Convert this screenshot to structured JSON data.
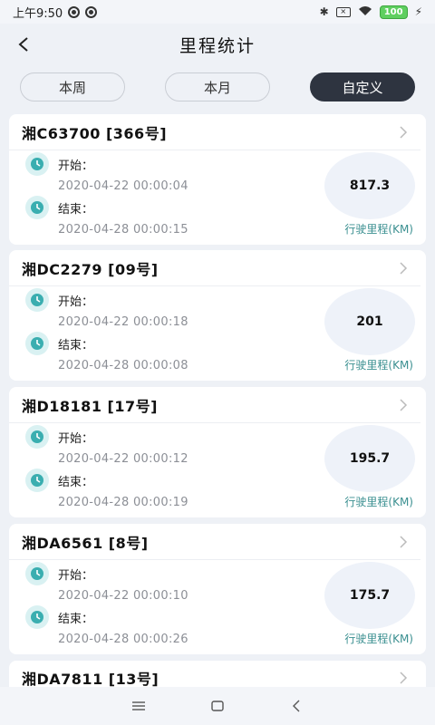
{
  "status_bar": {
    "time": "上午9:50",
    "battery": "100"
  },
  "header": {
    "title": "里程统计"
  },
  "filters": [
    {
      "label": "本周",
      "active": false
    },
    {
      "label": "本月",
      "active": false
    },
    {
      "label": "自定义",
      "active": true
    }
  ],
  "records": [
    {
      "plate": "湘C63700 [366号]",
      "start_label": "开始：",
      "start_time": "2020-04-22 00:00:04",
      "end_label": "结束：",
      "end_time": "2020-04-28 00:00:15",
      "mileage": "817.3",
      "mileage_label": "行驶里程(KM)"
    },
    {
      "plate": "湘DC2279 [09号]",
      "start_label": "开始：",
      "start_time": "2020-04-22 00:00:18",
      "end_label": "结束：",
      "end_time": "2020-04-28 00:00:08",
      "mileage": "201",
      "mileage_label": "行驶里程(KM)"
    },
    {
      "plate": "湘D18181 [17号]",
      "start_label": "开始：",
      "start_time": "2020-04-22 00:00:12",
      "end_label": "结束：",
      "end_time": "2020-04-28 00:00:19",
      "mileage": "195.7",
      "mileage_label": "行驶里程(KM)"
    },
    {
      "plate": "湘DA6561 [8号]",
      "start_label": "开始：",
      "start_time": "2020-04-22 00:00:10",
      "end_label": "结束：",
      "end_time": "2020-04-28 00:00:26",
      "mileage": "175.7",
      "mileage_label": "行驶里程(KM)"
    },
    {
      "plate": "湘DA7811 [13号]"
    }
  ],
  "colors": {
    "accent": "#3a8f90",
    "active_filter": "#2e3440",
    "icon_bg": "#d9f1f2"
  },
  "icons": {
    "back": "chevron-left-icon",
    "row_arrow": "chevron-right-icon",
    "time": "clock-icon"
  }
}
